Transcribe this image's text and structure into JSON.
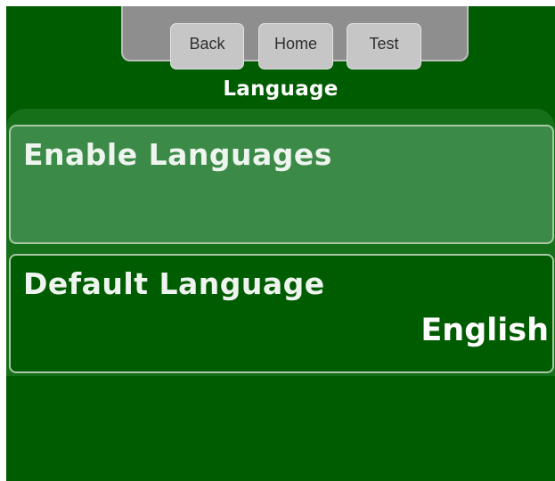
{
  "nav": {
    "back_label": "Back",
    "home_label": "Home",
    "test_label": "Test"
  },
  "page": {
    "title": "Language"
  },
  "settings": [
    {
      "label": "Enable Languages",
      "value": ""
    },
    {
      "label": "Default Language",
      "value": "English"
    }
  ],
  "colors": {
    "background": "#005c00",
    "selected_item": "#3b8a47",
    "nav_tray": "#8e8e8e",
    "nav_button": "#c6c6c6"
  }
}
